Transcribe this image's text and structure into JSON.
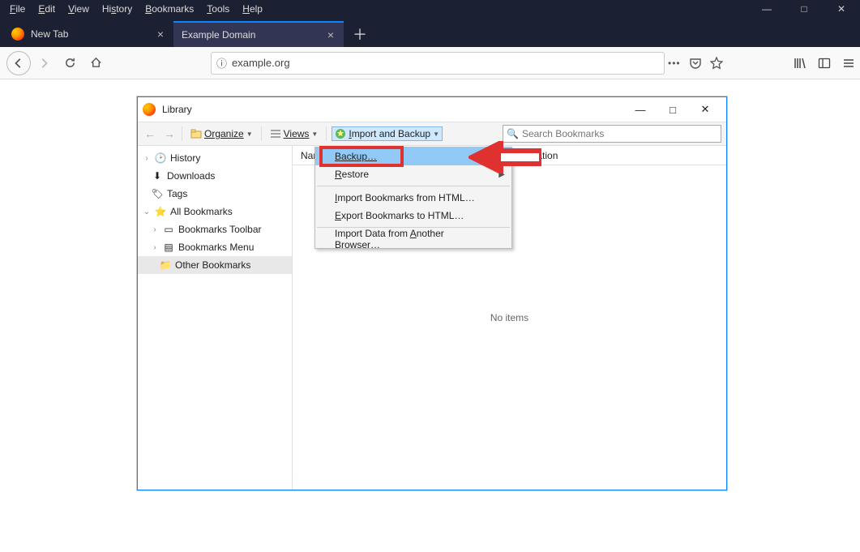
{
  "browser": {
    "menu": [
      "File",
      "Edit",
      "View",
      "History",
      "Bookmarks",
      "Tools",
      "Help"
    ],
    "tabs": [
      {
        "label": "New Tab",
        "active": false
      },
      {
        "label": "Example Domain",
        "active": true
      }
    ],
    "url": "example.org"
  },
  "library": {
    "title": "Library",
    "toolbar": {
      "organize": "Organize",
      "views": "Views",
      "import_backup": "Import and Backup"
    },
    "search_placeholder": "Search Bookmarks",
    "tree": {
      "history": "History",
      "downloads": "Downloads",
      "tags": "Tags",
      "all_bookmarks": "All Bookmarks",
      "bookmarks_toolbar": "Bookmarks Toolbar",
      "bookmarks_menu": "Bookmarks Menu",
      "other_bookmarks": "Other Bookmarks"
    },
    "columns": {
      "name": "Name",
      "location": "Location"
    },
    "empty": "No items",
    "menu": {
      "backup": "Backup…",
      "restore": "Restore",
      "import_html": "Import Bookmarks from HTML…",
      "export_html": "Export Bookmarks to HTML…",
      "import_other": "Import Data from Another Browser…"
    }
  }
}
